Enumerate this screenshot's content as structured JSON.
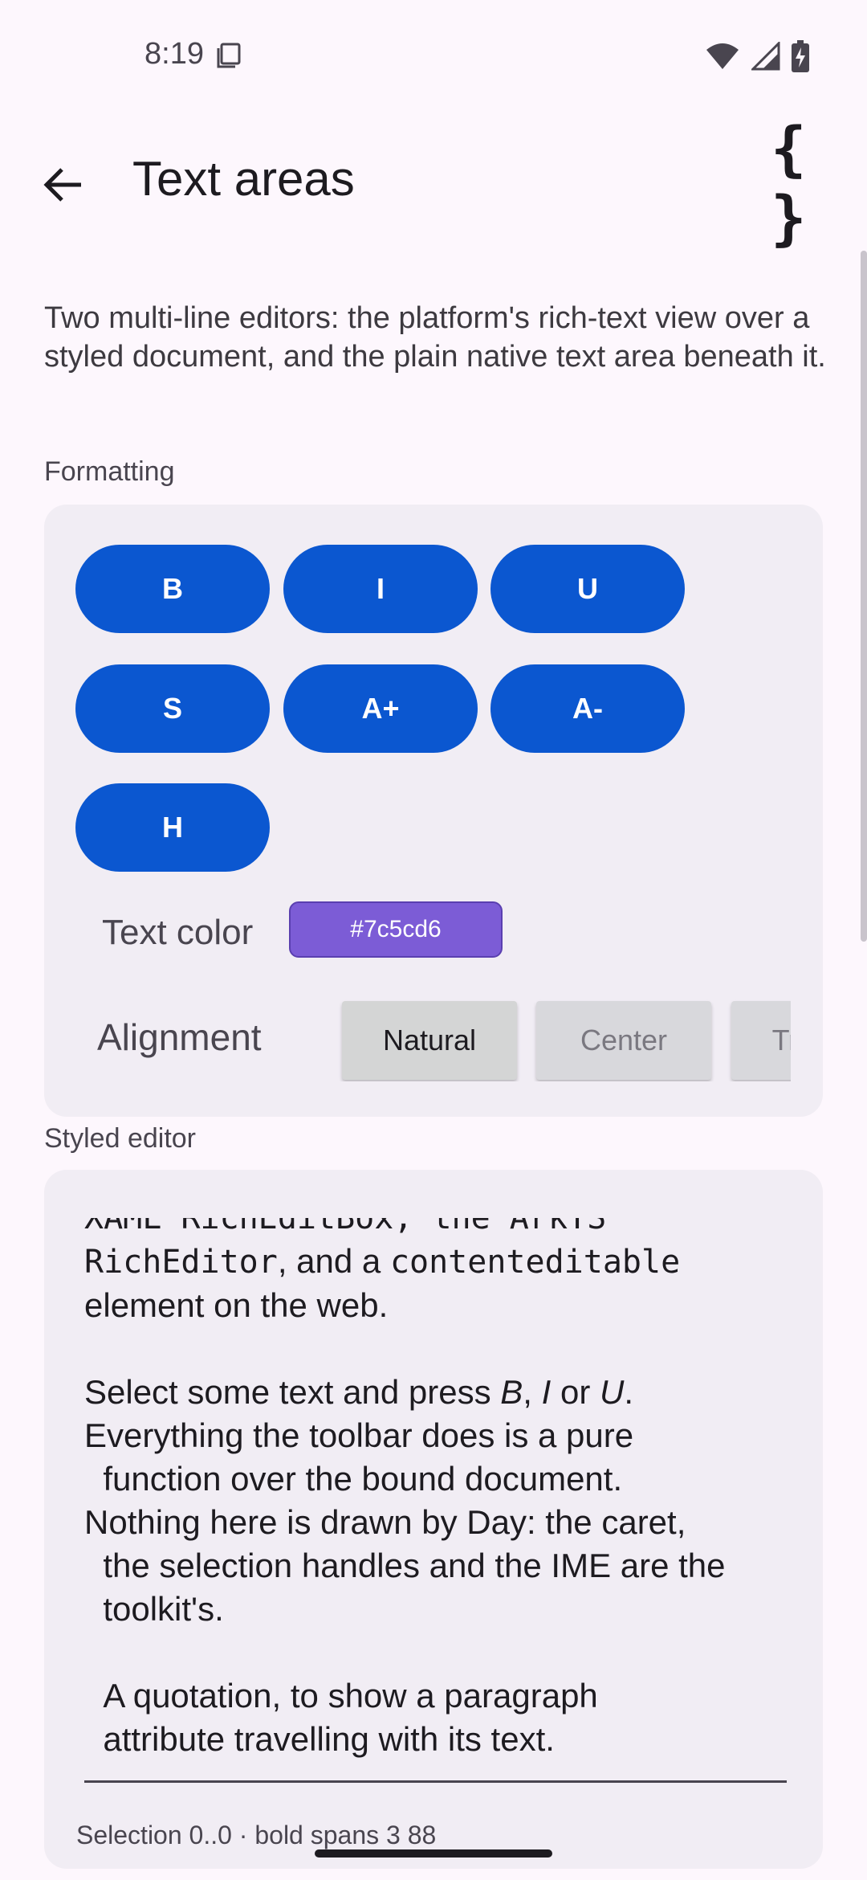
{
  "status": {
    "time": "8:19"
  },
  "app_bar": {
    "title": "Text areas",
    "braces_label": "{ }"
  },
  "description": "Two multi-line editors: the platform's rich-text view over a styled document, and the plain native text area beneath it.",
  "formatting": {
    "label": "Formatting",
    "buttons": [
      "B",
      "I",
      "U",
      "S",
      "A+",
      "A-",
      "H"
    ],
    "text_color": {
      "label": "Text color",
      "value": "#7c5cd6"
    },
    "alignment": {
      "label": "Alignment",
      "options": [
        "Natural",
        "Center",
        "Trailing"
      ],
      "selected": "Natural"
    }
  },
  "styled_editor": {
    "label": "Styled editor",
    "line1": "XAML RichEditBox, the ArkTS",
    "mono1": "RichEditor",
    "t1": ", and a ",
    "mono2": "contenteditable",
    "line3": "element on the web.",
    "p2a": "Select some text and press ",
    "b": "B",
    "comma": ", ",
    "i": "I",
    "or": " or ",
    "u": "U",
    "dot": ".",
    "p2b": "Everything the toolbar does is a pure\n  function over the bound document.\nNothing here is drawn by Day: the caret,\n  the selection handles and the IME are the\n  toolkit's.",
    "quote": "  A quotation, to show a paragraph\n  attribute travelling with its text.",
    "status": "Selection 0..0 · bold spans 3 88"
  },
  "colors": {
    "primary": "#0b57d0",
    "text_color": "#7c5cd6",
    "card": "#f1edf4",
    "background": "#fdf7fd"
  }
}
